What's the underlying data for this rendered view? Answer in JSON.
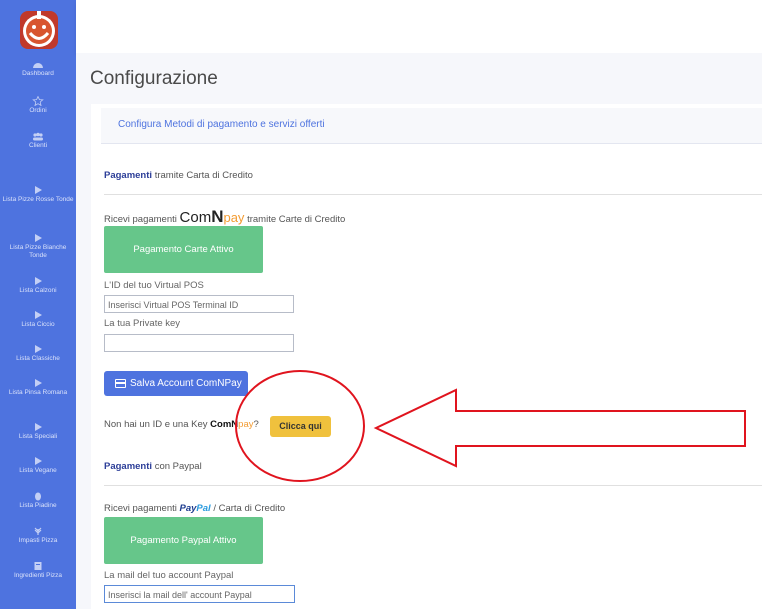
{
  "sidebar": {
    "items": [
      {
        "label": "Dashboard",
        "icon": "dashboard-icon"
      },
      {
        "label": "Ordini",
        "icon": "star-icon"
      },
      {
        "label": "Clienti",
        "icon": "users-icon"
      },
      {
        "label": "Lista Pizze Rosse Tonde",
        "icon": "pizza-slice-icon"
      },
      {
        "label": "Lista Pizze Bianche Tonde",
        "icon": "pizza-slice-icon"
      },
      {
        "label": "Lista Calzoni",
        "icon": "pizza-slice-icon"
      },
      {
        "label": "Lista Ciccio",
        "icon": "pizza-slice-icon"
      },
      {
        "label": "Lista Classiche",
        "icon": "pizza-slice-icon"
      },
      {
        "label": "Lista Pinsa Romana",
        "icon": "pizza-slice-icon"
      },
      {
        "label": "Lista Speciali",
        "icon": "pizza-slice-icon"
      },
      {
        "label": "Lista Vegane",
        "icon": "pizza-slice-icon"
      },
      {
        "label": "Lista Piadine",
        "icon": "egg-icon"
      },
      {
        "label": "Impasti Pizza",
        "icon": "wheat-icon"
      },
      {
        "label": "Ingredienti Pizza",
        "icon": "box-icon"
      }
    ]
  },
  "page": {
    "title": "Configurazione",
    "card_header": "Configura Metodi di pagamento e servizi offerti"
  },
  "card_payments": {
    "section_bold": "Pagamenti",
    "section_rest": "tramite Carta di Credito",
    "receive_prefix": "Ricevi pagamenti",
    "brand_comn": "Com",
    "brand_n": "N",
    "brand_pay": "pay",
    "receive_suffix": "tramite Carte di Credito",
    "active_button": "Pagamento Carte Attivo",
    "virtual_pos_label": "L'ID del tuo Virtual POS",
    "virtual_pos_placeholder": "Inserisci Virtual POS Terminal ID",
    "private_key_label": "La tua Private key",
    "private_key_value": "",
    "save_button": "Salva Account ComNPay",
    "no_id_prefix": "Non hai un ID e una Key",
    "no_id_brand_comn": "Com",
    "no_id_brand_n": "N",
    "no_id_brand_pay": "pay",
    "no_id_suffix": "?",
    "click_here": "Clicca qui"
  },
  "paypal": {
    "section_bold": "Pagamenti",
    "section_rest": "con Paypal",
    "receive_prefix": "Ricevi pagamenti",
    "brand_pay": "Pay",
    "brand_pal": "Pal",
    "receive_suffix": "/ Carta di Credito",
    "active_button": "Pagamento Paypal Attivo",
    "mail_label": "La mail del tuo account Paypal",
    "mail_placeholder": "Inserisci la mail dell' account Paypal"
  },
  "colors": {
    "sidebar": "#4e73df",
    "accent": "#4e73df",
    "success": "#66c68a",
    "warning": "#f0c13d",
    "annotation": "#e0141e"
  }
}
